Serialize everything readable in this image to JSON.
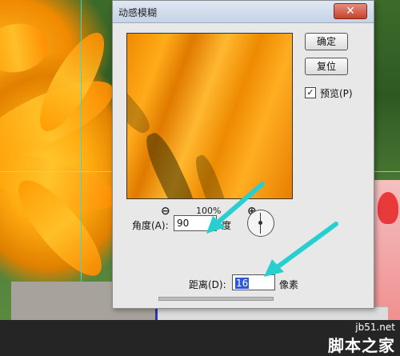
{
  "dialog": {
    "title": "动感模糊",
    "close_glyph": "✕",
    "buttons": {
      "ok": "确定",
      "reset": "复位"
    },
    "preview_checkbox": {
      "label": "预览(P)",
      "checked": true,
      "check_glyph": "✓"
    },
    "zoom": {
      "out_glyph": "⊖",
      "in_glyph": "⊕",
      "value": "100%"
    },
    "angle": {
      "label": "角度(A):",
      "value": "90",
      "unit": "度"
    },
    "distance": {
      "label": "距离(D):",
      "value": "16",
      "unit": "像素"
    }
  },
  "colors": {
    "arrow": "#27cfd0",
    "accent_blue": "#2a5bd0"
  },
  "watermark": {
    "url": "jb51.net",
    "name": "脚本之家"
  },
  "icons": [
    "close-icon",
    "zoom-out-icon",
    "zoom-in-icon",
    "check-icon",
    "angle-dial-icon"
  ]
}
